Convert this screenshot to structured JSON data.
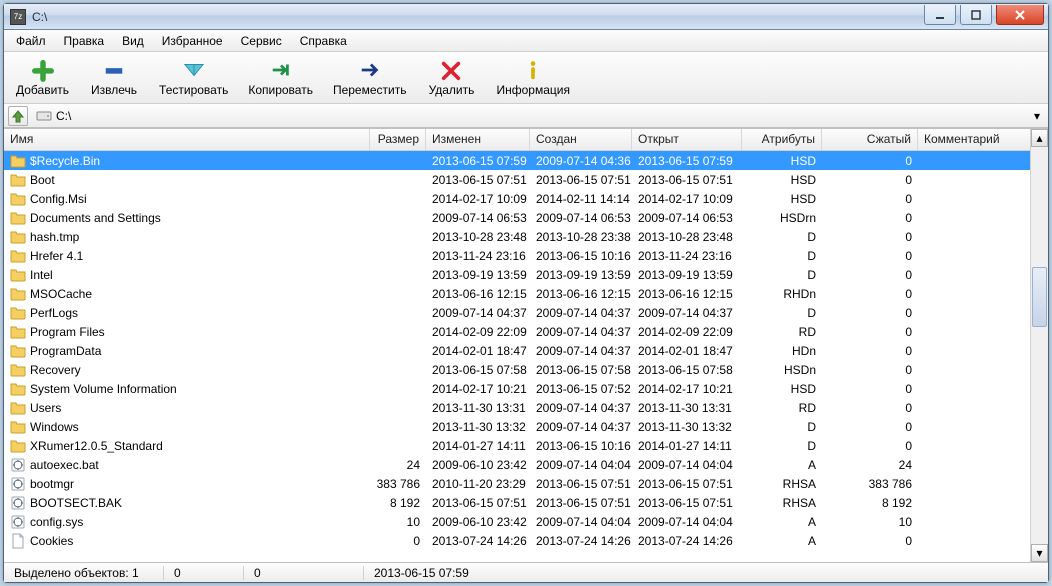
{
  "window": {
    "title": "C:\\"
  },
  "menu": [
    "Файл",
    "Правка",
    "Вид",
    "Избранное",
    "Сервис",
    "Справка"
  ],
  "toolbar": [
    {
      "name": "add",
      "label": "Добавить"
    },
    {
      "name": "extract",
      "label": "Извлечь"
    },
    {
      "name": "test",
      "label": "Тестировать"
    },
    {
      "name": "copy",
      "label": "Копировать"
    },
    {
      "name": "move",
      "label": "Переместить"
    },
    {
      "name": "delete",
      "label": "Удалить"
    },
    {
      "name": "info",
      "label": "Информация"
    }
  ],
  "address": {
    "path": "C:\\"
  },
  "columns": {
    "name": "Имя",
    "size": "Размер",
    "modified": "Изменен",
    "created": "Создан",
    "opened": "Открыт",
    "attrs": "Атрибуты",
    "packed": "Сжатый",
    "comment": "Комментарий"
  },
  "rows": [
    {
      "icon": "folder",
      "name": "$Recycle.Bin",
      "size": "",
      "mod": "2013-06-15 07:59",
      "cre": "2009-07-14 04:36",
      "open": "2013-06-15 07:59",
      "attr": "HSD",
      "pack": "0",
      "selected": true
    },
    {
      "icon": "folder",
      "name": "Boot",
      "size": "",
      "mod": "2013-06-15 07:51",
      "cre": "2013-06-15 07:51",
      "open": "2013-06-15 07:51",
      "attr": "HSD",
      "pack": "0"
    },
    {
      "icon": "folder",
      "name": "Config.Msi",
      "size": "",
      "mod": "2014-02-17 10:09",
      "cre": "2014-02-11 14:14",
      "open": "2014-02-17 10:09",
      "attr": "HSD",
      "pack": "0"
    },
    {
      "icon": "folder",
      "name": "Documents and Settings",
      "size": "",
      "mod": "2009-07-14 06:53",
      "cre": "2009-07-14 06:53",
      "open": "2009-07-14 06:53",
      "attr": "HSDrn",
      "pack": "0"
    },
    {
      "icon": "folder",
      "name": "hash.tmp",
      "size": "",
      "mod": "2013-10-28 23:48",
      "cre": "2013-10-28 23:38",
      "open": "2013-10-28 23:48",
      "attr": "D",
      "pack": "0"
    },
    {
      "icon": "folder",
      "name": "Hrefer 4.1",
      "size": "",
      "mod": "2013-11-24 23:16",
      "cre": "2013-06-15 10:16",
      "open": "2013-11-24 23:16",
      "attr": "D",
      "pack": "0"
    },
    {
      "icon": "folder",
      "name": "Intel",
      "size": "",
      "mod": "2013-09-19 13:59",
      "cre": "2013-09-19 13:59",
      "open": "2013-09-19 13:59",
      "attr": "D",
      "pack": "0"
    },
    {
      "icon": "folder",
      "name": "MSOCache",
      "size": "",
      "mod": "2013-06-16 12:15",
      "cre": "2013-06-16 12:15",
      "open": "2013-06-16 12:15",
      "attr": "RHDn",
      "pack": "0"
    },
    {
      "icon": "folder",
      "name": "PerfLogs",
      "size": "",
      "mod": "2009-07-14 04:37",
      "cre": "2009-07-14 04:37",
      "open": "2009-07-14 04:37",
      "attr": "D",
      "pack": "0"
    },
    {
      "icon": "folder",
      "name": "Program Files",
      "size": "",
      "mod": "2014-02-09 22:09",
      "cre": "2009-07-14 04:37",
      "open": "2014-02-09 22:09",
      "attr": "RD",
      "pack": "0"
    },
    {
      "icon": "folder",
      "name": "ProgramData",
      "size": "",
      "mod": "2014-02-01 18:47",
      "cre": "2009-07-14 04:37",
      "open": "2014-02-01 18:47",
      "attr": "HDn",
      "pack": "0"
    },
    {
      "icon": "folder",
      "name": "Recovery",
      "size": "",
      "mod": "2013-06-15 07:58",
      "cre": "2013-06-15 07:58",
      "open": "2013-06-15 07:58",
      "attr": "HSDn",
      "pack": "0"
    },
    {
      "icon": "folder",
      "name": "System Volume Information",
      "size": "",
      "mod": "2014-02-17 10:21",
      "cre": "2013-06-15 07:52",
      "open": "2014-02-17 10:21",
      "attr": "HSD",
      "pack": "0"
    },
    {
      "icon": "folder",
      "name": "Users",
      "size": "",
      "mod": "2013-11-30 13:31",
      "cre": "2009-07-14 04:37",
      "open": "2013-11-30 13:31",
      "attr": "RD",
      "pack": "0"
    },
    {
      "icon": "folder",
      "name": "Windows",
      "size": "",
      "mod": "2013-11-30 13:32",
      "cre": "2009-07-14 04:37",
      "open": "2013-11-30 13:32",
      "attr": "D",
      "pack": "0"
    },
    {
      "icon": "folder",
      "name": "XRumer12.0.5_Standard",
      "size": "",
      "mod": "2014-01-27 14:11",
      "cre": "2013-06-15 10:16",
      "open": "2014-01-27 14:11",
      "attr": "D",
      "pack": "0"
    },
    {
      "icon": "gear",
      "name": "autoexec.bat",
      "size": "24",
      "mod": "2009-06-10 23:42",
      "cre": "2009-07-14 04:04",
      "open": "2009-07-14 04:04",
      "attr": "A",
      "pack": "24"
    },
    {
      "icon": "gear",
      "name": "bootmgr",
      "size": "383 786",
      "mod": "2010-11-20 23:29",
      "cre": "2013-06-15 07:51",
      "open": "2013-06-15 07:51",
      "attr": "RHSA",
      "pack": "383 786"
    },
    {
      "icon": "gear",
      "name": "BOOTSECT.BAK",
      "size": "8 192",
      "mod": "2013-06-15 07:51",
      "cre": "2013-06-15 07:51",
      "open": "2013-06-15 07:51",
      "attr": "RHSA",
      "pack": "8 192"
    },
    {
      "icon": "gear",
      "name": "config.sys",
      "size": "10",
      "mod": "2009-06-10 23:42",
      "cre": "2009-07-14 04:04",
      "open": "2009-07-14 04:04",
      "attr": "A",
      "pack": "10"
    },
    {
      "icon": "file",
      "name": "Cookies",
      "size": "0",
      "mod": "2013-07-24 14:26",
      "cre": "2013-07-24 14:26",
      "open": "2013-07-24 14:26",
      "attr": "A",
      "pack": "0"
    }
  ],
  "status": {
    "selected": "Выделено объектов: 1",
    "seg2": "0",
    "seg3": "0",
    "seg4": "2013-06-15 07:59"
  }
}
